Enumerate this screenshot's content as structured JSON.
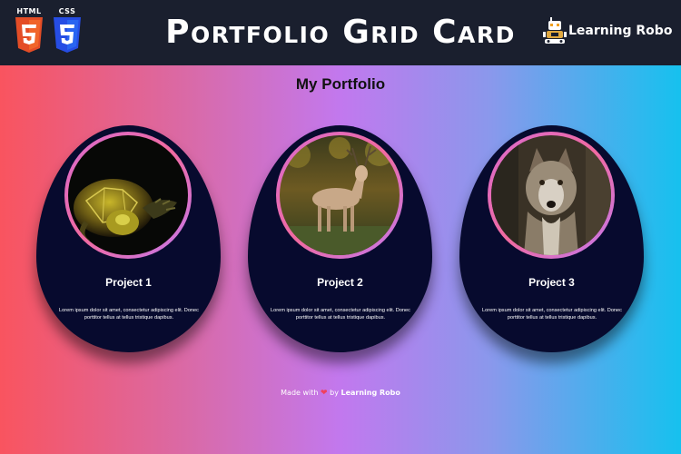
{
  "header": {
    "html_badge": "HTML",
    "css_badge": "CSS",
    "title": "Portfolio Grid Card",
    "brand": "Learning Robo"
  },
  "page": {
    "heading": "My Portfolio"
  },
  "cards": [
    {
      "title": "Project 1",
      "description": "Lorem ipsum dolor sit amet, consectetur adipiscing elit. Donec porttitor tellus at tellus tristique dapibus."
    },
    {
      "title": "Project 2",
      "description": "Lorem ipsum dolor sit amet, consectetur adipiscing elit. Donec porttitor tellus at tellus tristique dapibus."
    },
    {
      "title": "Project 3",
      "description": "Lorem ipsum dolor sit amet, consectetur adipiscing elit. Donec porttitor tellus at tellus tristique dapibus."
    }
  ],
  "footer": {
    "made_with": "Made with",
    "heart": "❤",
    "by": "by",
    "credit": "Learning Robo"
  },
  "colors": {
    "topbar": "#1a1f2e",
    "card": "#070a2e",
    "ring": "#d96bd0",
    "heart": "#f0405c"
  }
}
